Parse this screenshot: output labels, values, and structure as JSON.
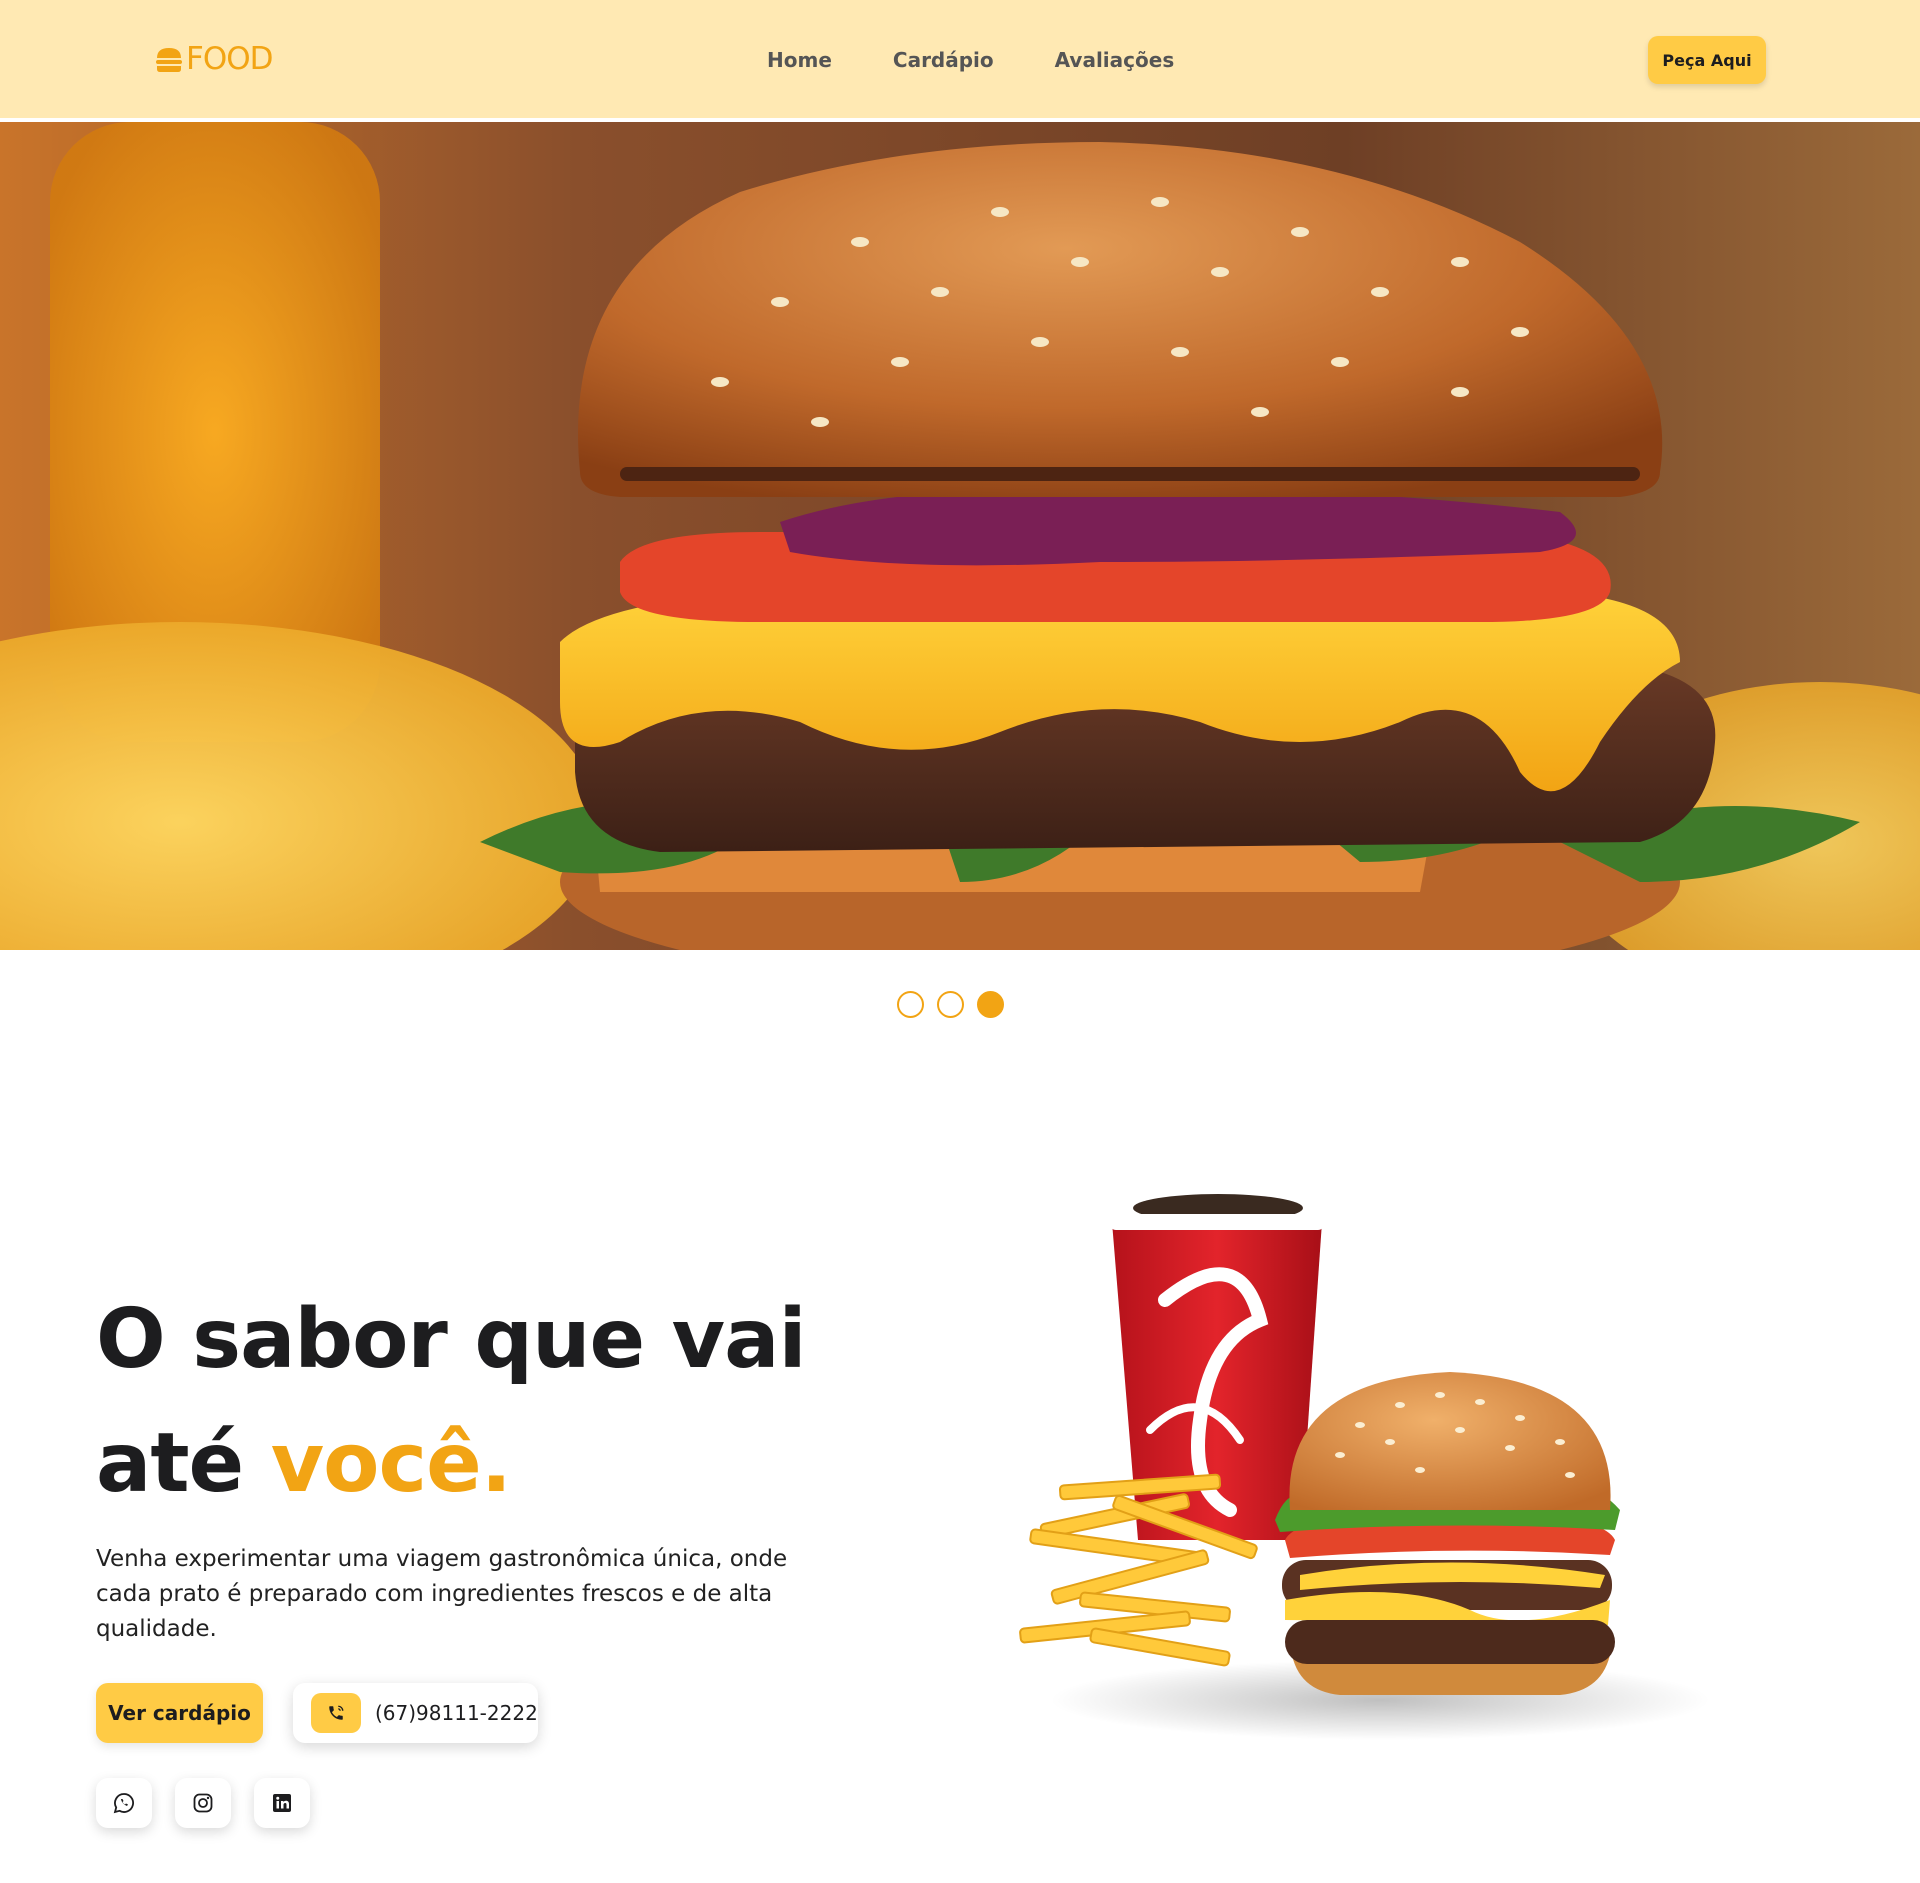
{
  "header": {
    "logo_text": "FOOD",
    "nav": [
      "Home",
      "Cardápio",
      "Avaliações"
    ],
    "order_label": "Peça Aqui"
  },
  "carousel": {
    "slide_count": 3,
    "active_index": 2
  },
  "hero": {
    "headline_line1": "O sabor que vai",
    "headline_line2_start": "até ",
    "headline_accent": "você.",
    "description": "Venha experimentar uma viagem gastronômica única, onde cada prato é preparado com ingredientes frescos e de alta qualidade.",
    "menu_button": "Ver cardápio",
    "phone": "(67)98111-2222"
  },
  "socials": {
    "icons": [
      "whatsapp-icon",
      "instagram-icon",
      "linkedin-icon"
    ]
  },
  "colors": {
    "accent": "#f2a414",
    "button": "#ffcb45",
    "header_bg": "#ffe9b3",
    "text": "#1d1d1f"
  }
}
